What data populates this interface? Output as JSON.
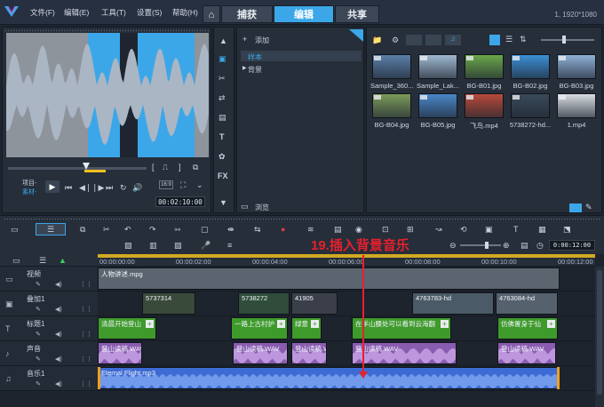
{
  "app": {
    "menu": [
      "文件(F)",
      "编辑(E)",
      "工具(T)",
      "设置(S)",
      "帮助(H)"
    ],
    "nav_tabs": [
      "捕获",
      "编辑",
      "共享"
    ],
    "resolution": "1, 1920*1080"
  },
  "player": {
    "mode_labels": [
      "项目-",
      "素材-"
    ],
    "timecode": "00:02:10:00",
    "zoom_text": "16:9"
  },
  "library": {
    "add_label": "添加",
    "folders": [
      "样本",
      "背景"
    ],
    "browse_label": "浏览",
    "items": [
      {
        "name": "Sample_360...",
        "kind": "video",
        "color": "#5a7fa8"
      },
      {
        "name": "Sample_Lak...",
        "kind": "video",
        "color": "#9fb8d0"
      },
      {
        "name": "BG-B01.jpg",
        "kind": "image",
        "color": "#6aa64a"
      },
      {
        "name": "BG-B02.jpg",
        "kind": "image",
        "color": "#3c8fd6"
      },
      {
        "name": "BG-B03.jpg",
        "kind": "image",
        "color": "#8fb0d8"
      },
      {
        "name": "BG-B04.jpg",
        "kind": "image",
        "color": "#7b9b5a"
      },
      {
        "name": "BG-B05.jpg",
        "kind": "image",
        "color": "#4a86c8"
      },
      {
        "name": "飞鸟.mp4",
        "kind": "video",
        "color": "#b84a3a"
      },
      {
        "name": "5738272-hd...",
        "kind": "video",
        "color": "#3a4a5a"
      },
      {
        "name": "1.mp4",
        "kind": "video",
        "color": "#d8dde3"
      }
    ]
  },
  "annotation": "19.插入背景音乐",
  "timeline": {
    "ruler": [
      "00:00:00:00",
      "00:00:02:00",
      "00:00:04:00",
      "00:00:06:00",
      "00:00:08:00",
      "00:00:10:00",
      "00:00:12:00"
    ],
    "zoom_timecode": "0:00:12:00",
    "tracks": [
      {
        "name": "视频",
        "clips": [
          {
            "label": "人物讲述.mpg",
            "color": "#5c6470"
          }
        ]
      },
      {
        "name": "叠加1",
        "clips": [
          {
            "label": "5737314",
            "color": "#3a4a3a"
          },
          {
            "label": "5738272",
            "color": "#2f4d3a"
          },
          {
            "label": "41905",
            "color": "#3a3f4a"
          },
          {
            "label": "4763783-hd",
            "color": "#4a5a66"
          },
          {
            "label": "4763084-hd",
            "color": "#55626d"
          }
        ]
      },
      {
        "name": "标题1",
        "clips": [
          {
            "label": "清晨开始登山",
            "color": "#3f9a2c"
          },
          {
            "label": "一路上古村护",
            "color": "#3f9a2c"
          },
          {
            "label": "绿意",
            "color": "#3f9a2c"
          },
          {
            "label": "在半山腰处可以看到云海翻",
            "color": "#3f9a2c"
          },
          {
            "label": "仿佛置身于仙",
            "color": "#3f9a2c"
          }
        ]
      },
      {
        "name": "声音",
        "clips": [
          {
            "label": "登山读稿.WAV",
            "color": "#8a5cb0"
          },
          {
            "label": "登山读稿.WAV",
            "color": "#8a5cb0"
          },
          {
            "label": "登山读稿.WAV",
            "color": "#8a5cb0"
          },
          {
            "label": "登山读稿.WAV",
            "color": "#8a5cb0"
          },
          {
            "label": "登山读稿.WAV",
            "color": "#8a5cb0"
          }
        ]
      },
      {
        "name": "音乐1",
        "clips": [
          {
            "label": "Eternal Flight.mp3",
            "color": "#3d6bd4"
          }
        ]
      }
    ]
  }
}
